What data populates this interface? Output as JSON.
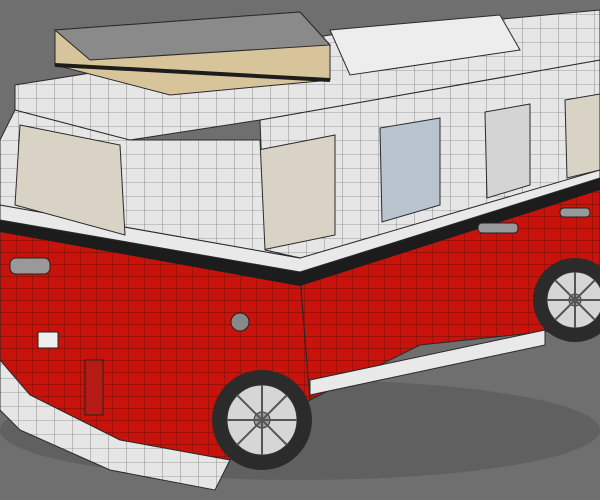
{
  "colors": {
    "background": "#6f6f6f",
    "body_red": "#c8120c",
    "body_red_dark": "#8e0c08",
    "white_panel": "#e9e9e9",
    "white_shade": "#c9c9c9",
    "wire": "#2a2a2a",
    "roof_rack_tan": "#d8c49a",
    "window_glass": "#d9d3c6",
    "stripe_dark": "#1c1c1c",
    "tire": "#2b2b2b",
    "rim": "#d6d6d6"
  }
}
